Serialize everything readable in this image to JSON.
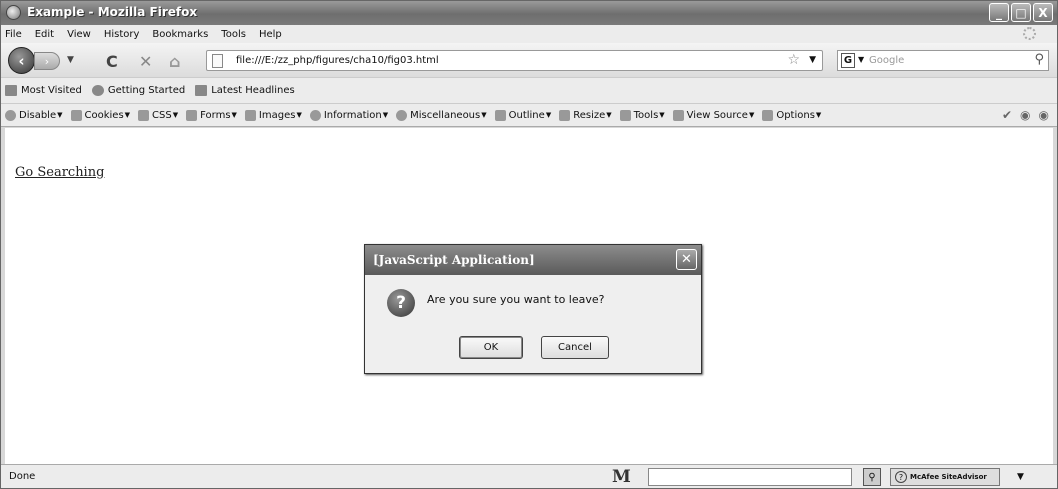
{
  "window": {
    "title": "Example - Mozilla Firefox",
    "buttons": [
      "_",
      "□",
      "X"
    ]
  },
  "menu": [
    "File",
    "Edit",
    "View",
    "History",
    "Bookmarks",
    "Tools",
    "Help"
  ],
  "nav": {
    "back_glyph": "‹",
    "forward_glyph": "›",
    "reload_glyph": "C",
    "stop_glyph": "✕",
    "home_glyph": "⌂",
    "url": "file:///E:/zz_php/figures/cha10/fig03.html",
    "search_placeholder": "Google",
    "search_engine_glyph": "G"
  },
  "bookmarks": [
    "Most Visited",
    "Getting Started",
    "Latest Headlines"
  ],
  "devtoolbar": [
    "Disable",
    "Cookies",
    "CSS",
    "Forms",
    "Images",
    "Information",
    "Miscellaneous",
    "Outline",
    "Resize",
    "Tools",
    "View Source",
    "Options"
  ],
  "content": {
    "link_text": "Go Searching"
  },
  "dialog": {
    "title": "[JavaScript Application]",
    "message": "Are you sure you want to leave?",
    "ok_label": "OK",
    "cancel_label": "Cancel",
    "icon_glyph": "?"
  },
  "status": {
    "text": "Done",
    "m_label": "M",
    "siteadvisor": "McAfee SiteAdvisor"
  },
  "colors": {
    "titlebar": "#6e6e6e",
    "chrome": "#ececec",
    "content": "#ffffff"
  }
}
